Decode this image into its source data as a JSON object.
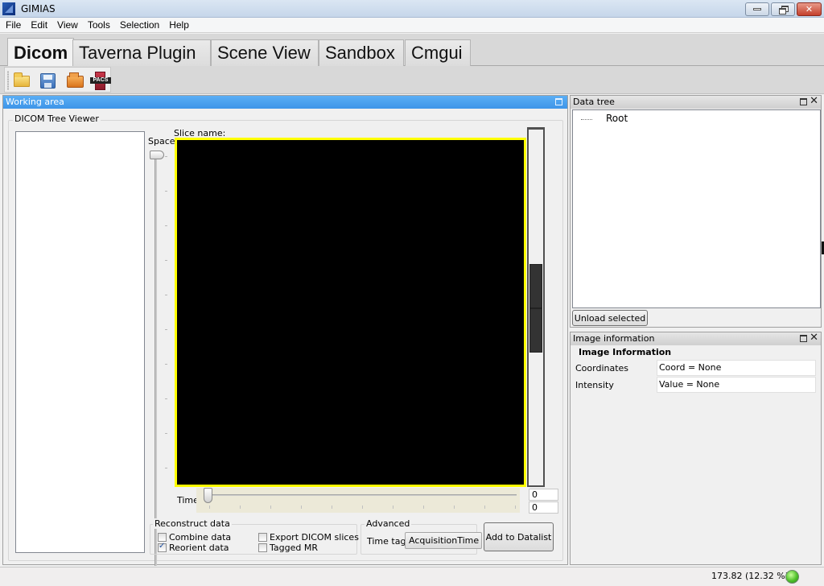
{
  "window": {
    "title": "GIMIAS",
    "controls": {
      "minimize": "minimize",
      "maximize": "restore",
      "close": "close"
    }
  },
  "menu": [
    "File",
    "Edit",
    "View",
    "Tools",
    "Selection",
    "Help"
  ],
  "tabs": [
    {
      "label": "Dicom",
      "active": true
    },
    {
      "label": "Taverna Plugin",
      "active": false
    },
    {
      "label": "Scene View",
      "active": false
    },
    {
      "label": "Sandbox",
      "active": false
    },
    {
      "label": "Cmgui",
      "active": false
    }
  ],
  "toolbar": {
    "icons": [
      "open-folder-icon",
      "save-icon",
      "open-directory-icon",
      "pacs-icon"
    ],
    "pacs_label": "PACS"
  },
  "working_area": {
    "title": "Working area",
    "group_title": "DICOM Tree Viewer",
    "space_label": "Space",
    "slice_name_label": "Slice name:",
    "slice_name_value": "",
    "time_label": "Time",
    "time_value": "0",
    "time_max": "0",
    "viewer_border_color": "#ffff00",
    "reconstruct": {
      "title": "Reconstruct data",
      "options": [
        {
          "label": "Combine data",
          "checked": false
        },
        {
          "label": "Reorient data",
          "checked": true
        },
        {
          "label": "Export DICOM slices",
          "checked": false
        },
        {
          "label": "Tagged MR",
          "checked": false
        }
      ]
    },
    "advanced": {
      "title": "Advanced",
      "time_tag_label": "Time tag",
      "time_tag_value": "AcquisitionTime"
    },
    "add_button": "Add to Datalist"
  },
  "data_tree": {
    "title": "Data tree",
    "root": "Root",
    "unload_button": "Unload selected"
  },
  "image_info": {
    "title": "Image information",
    "heading": "Image Information",
    "rows": [
      {
        "label": "Coordinates",
        "value": "Coord = None"
      },
      {
        "label": "Intensity",
        "value": "Value = None"
      }
    ]
  },
  "status": {
    "memory": "173.82  (12.32 %)",
    "indicator_color": "#4fc02a"
  }
}
